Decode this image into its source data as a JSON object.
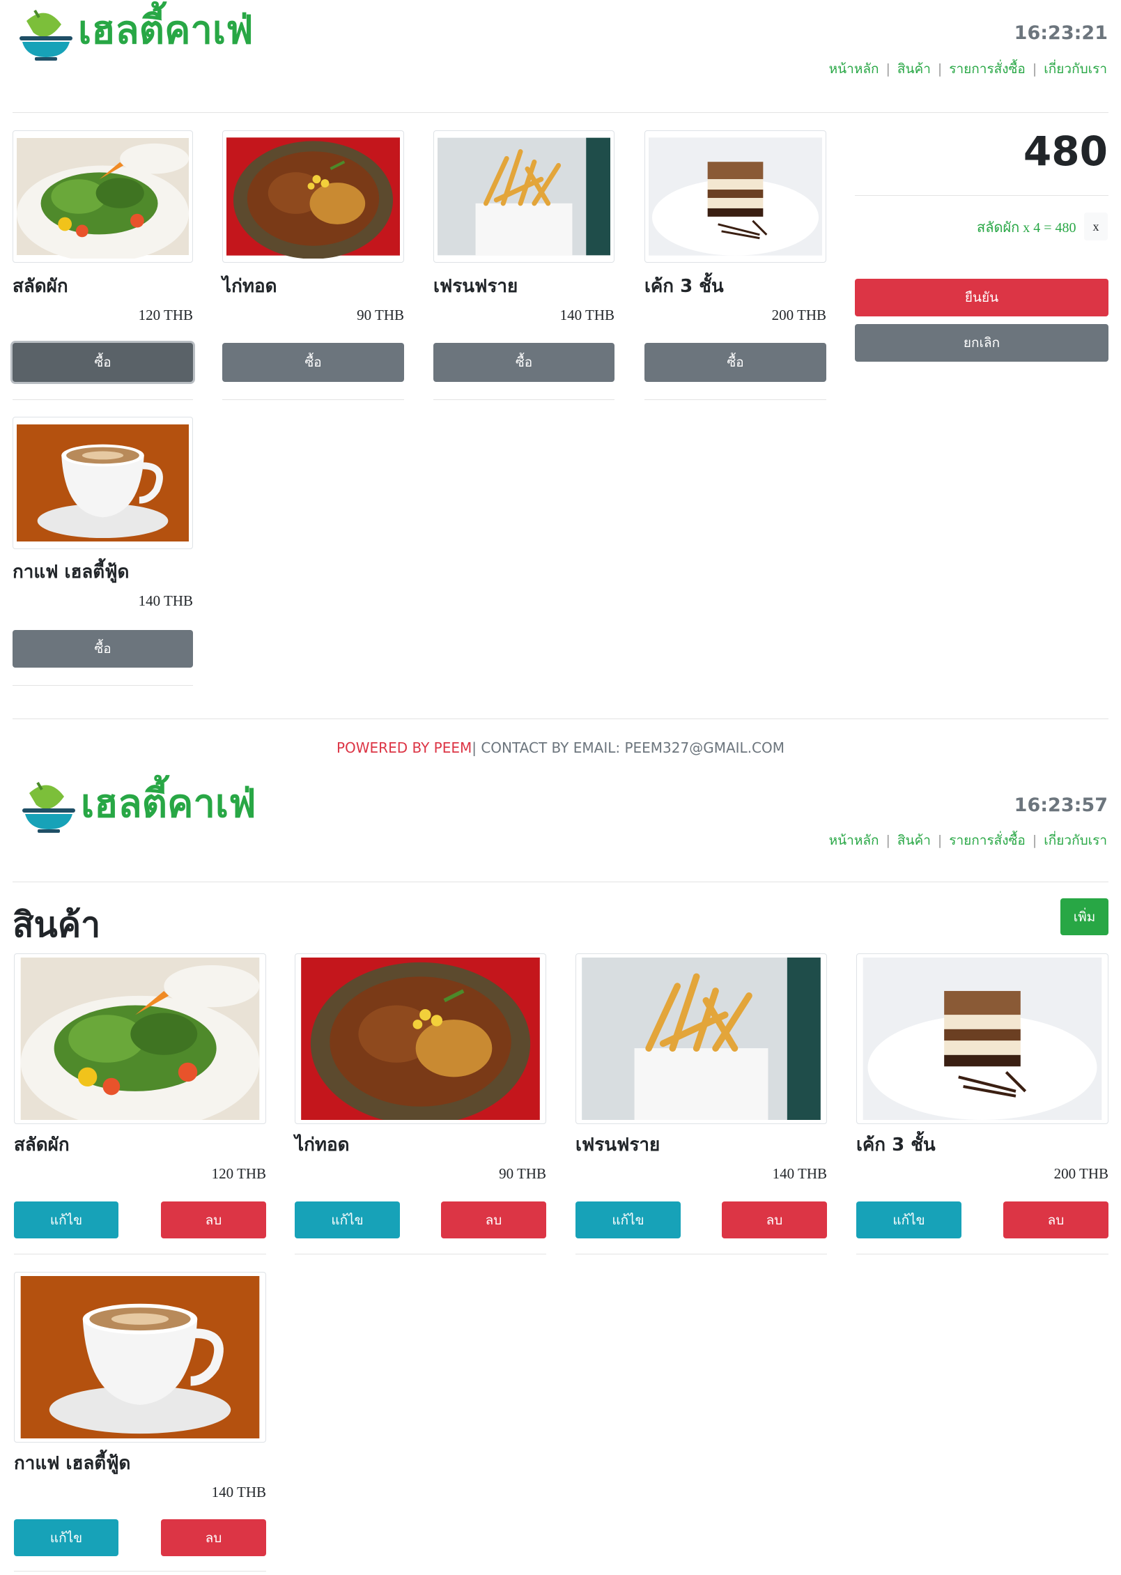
{
  "brand": {
    "name": "เฮลตี้คาเฟ่"
  },
  "nav": {
    "items": [
      "หน้าหลัก",
      "สินค้า",
      "รายการสั่งซื้อ",
      "เกี่ยวกับเรา"
    ]
  },
  "screen1": {
    "time": "16:23:21",
    "products": [
      {
        "name": "สลัดผัก",
        "price": "120 THB",
        "icon": "salad-image"
      },
      {
        "name": "ไก่ทอด",
        "price": "90 THB",
        "icon": "fried-chicken-image"
      },
      {
        "name": "เฟรนฟราย",
        "price": "140 THB",
        "icon": "french-fries-image"
      },
      {
        "name": "เค้ก 3 ชั้น",
        "price": "200 THB",
        "icon": "cake-image"
      },
      {
        "name": "กาแฟ เฮลตี้ฟู้ด",
        "price": "140 THB",
        "icon": "coffee-image"
      }
    ],
    "buy_label": "ซื้อ",
    "cart": {
      "total": "480",
      "items": [
        {
          "text": "สลัดผัก x 4 = 480",
          "remove_label": "x"
        }
      ],
      "confirm_label": "ยืนยัน",
      "cancel_label": "ยกเลิก"
    }
  },
  "footer": {
    "powered": "POWERED BY PEEM",
    "contact": "| CONTACT BY EMAIL: PEEM327@GMAIL.COM"
  },
  "screen2": {
    "time": "16:23:57",
    "title": "สินค้า",
    "add_label": "เพิ่ม",
    "edit_label": "แก้ไข",
    "delete_label": "ลบ",
    "products": [
      {
        "name": "สลัดผัก",
        "price": "120 THB"
      },
      {
        "name": "ไก่ทอด",
        "price": "90 THB"
      },
      {
        "name": "เฟรนฟราย",
        "price": "140 THB"
      },
      {
        "name": "เค้ก 3 ชั้น",
        "price": "200 THB"
      },
      {
        "name": "กาแฟ เฮลตี้ฟู้ด",
        "price": "140 THB"
      }
    ]
  },
  "colors": {
    "brand_green": "#28a745",
    "danger": "#dc3545",
    "info": "#17a2b8",
    "secondary": "#6c757d"
  }
}
